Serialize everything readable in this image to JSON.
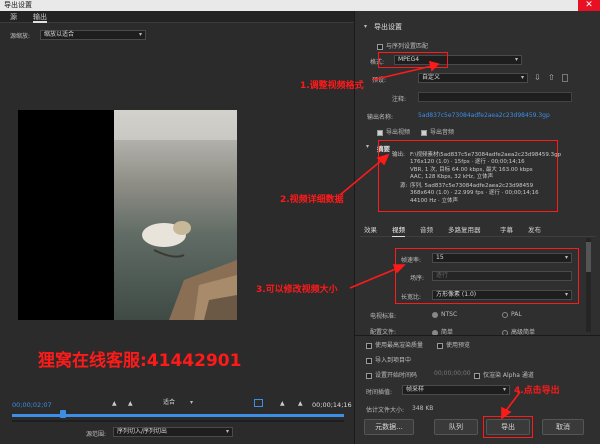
{
  "window": {
    "title": "导出设置",
    "close_glyph": "✕"
  },
  "source_tabs": [
    {
      "label": "源"
    },
    {
      "label": "输出"
    }
  ],
  "source": {
    "scaling_label": "源缩放:",
    "scaling_value": "缩放以适合"
  },
  "overlay": {
    "text": "狸窝在线客服:41442901"
  },
  "timeline": {
    "current_time": "00;00;02;07",
    "end_time": "00;00;14;16",
    "fit_value": "适合",
    "range_label": "源范围:",
    "range_value": "序列切入/序列切出"
  },
  "export_settings": {
    "header": "导出设置",
    "match_sequence_label": "与序列设置匹配",
    "format_label": "格式:",
    "format_value": "MPEG4",
    "preset_label": "预设:",
    "preset_value": "自定义",
    "comments_label": "注释:",
    "output_name_label": "输出名称:",
    "output_name_value": "5ad837c5e73084adfe2aea2c23d98459.3gp",
    "export_video_label": "导出视频",
    "export_audio_label": "导出音频"
  },
  "summary": {
    "header": "摘要",
    "output_label": "输出:",
    "output_lines": [
      "F:\\视频素材\\5ad837c5e73084adfe2aea2c23d98459.3gp",
      "176x120 (1.0) · 15fps · 逐行 · 00;00;14;16",
      "VBR, 1 次, 目标 64.00 kbps, 最大 163.00 kbps",
      "AAC, 128 Kbps, 32 kHz, 立体声"
    ],
    "source_label": "源:",
    "source_lines": [
      "序列, 5ad837c5e73084adfe2aea2c23d98459",
      "368x640 (1.0) · 22.999 fps · 逐行 · 00;00;14;16",
      "44100 Hz · 立体声"
    ]
  },
  "settings_tabs": [
    {
      "label": "效果"
    },
    {
      "label": "视频"
    },
    {
      "label": "音频"
    },
    {
      "label": "多路复用器"
    },
    {
      "label": "字幕"
    },
    {
      "label": "发布"
    }
  ],
  "video_settings": {
    "frame_rate_label": "帧速率:",
    "frame_rate_value": "15",
    "field_label": "场序:",
    "field_value": "逐行",
    "aspect_label": "长宽比:",
    "aspect_value": "方形像素 (1.0)",
    "tv_standard_label": "电视标准:",
    "ntsc_label": "NTSC",
    "pal_label": "PAL",
    "profile_label": "配置文件:",
    "profile_simple": "简单",
    "profile_advanced": "高级简单"
  },
  "bottom_options": {
    "max_render_quality": "使用最高渲染质量",
    "use_previews": "使用预览",
    "import_into_project": "导入到项目中",
    "set_start_timecode": "设置开始时间码",
    "start_timecode_value": "00;00;00;00",
    "render_alpha_only": "仅渲染 Alpha 通道",
    "time_interpolation_label": "时间插值:",
    "time_interpolation_value": "帧采样",
    "file_size_label": "估计文件大小:",
    "file_size_value": "348 KB"
  },
  "buttons": {
    "metadata": "元数据...",
    "queue": "队列",
    "export": "导出",
    "cancel": "取消"
  },
  "annotations": {
    "step1": "1.调整视频格式",
    "step2": "2.视频详细数据",
    "step3": "3.可以修改视频大小",
    "step4": "4.点击导出"
  },
  "colors": {
    "annotation": "#ff1a1a",
    "link": "#3d8ee6",
    "playhead": "#3d8ee6"
  }
}
